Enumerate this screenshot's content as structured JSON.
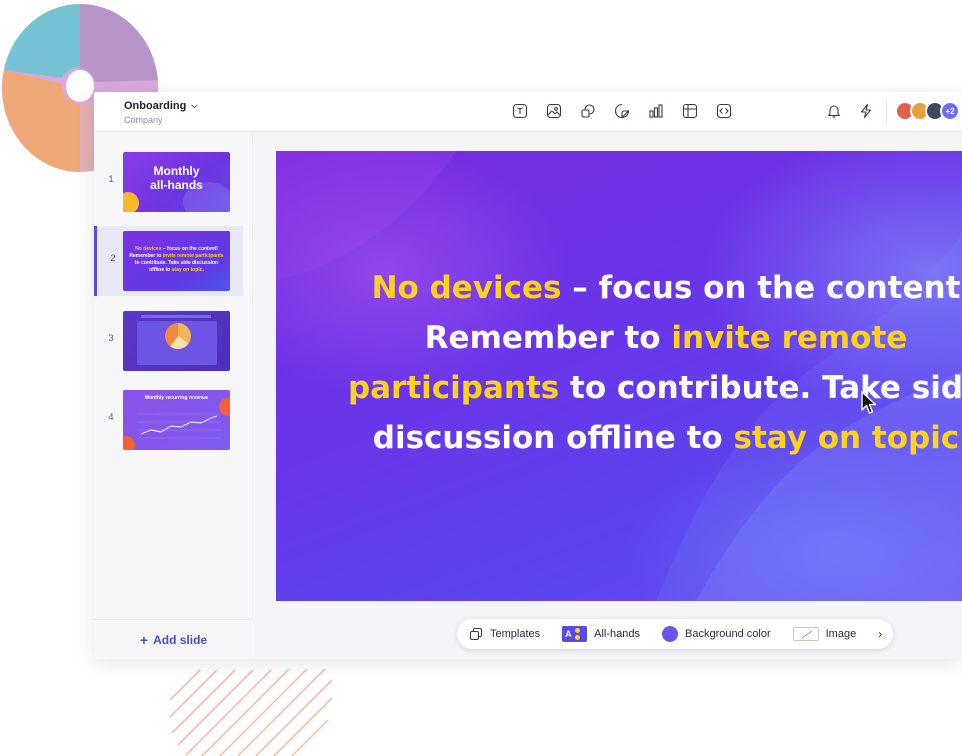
{
  "header": {
    "doc_title": "Onboarding",
    "doc_subtitle": "Company",
    "tools": [
      "text-icon",
      "image-icon",
      "shapes-icon",
      "sticker-icon",
      "chart-icon",
      "table-icon",
      "embed-icon"
    ],
    "notifications_icon": "bell-icon",
    "actions_icon": "lightning-icon",
    "collaborators_extra": "+2",
    "avatar_colors": [
      "#e2604a",
      "#e9a23b",
      "#3f4860",
      "#6b6ff0"
    ]
  },
  "sidebar": {
    "slides": [
      {
        "number": "1",
        "title_line1": "Monthly",
        "title_line2": "all-hands"
      },
      {
        "number": "2",
        "text": [
          "No devices",
          " – focus on the content! Remember to ",
          "invite remote participants",
          " to contribute. Take side discussion offline to ",
          "stay on topic",
          "."
        ]
      },
      {
        "number": "3"
      },
      {
        "number": "4",
        "title": "Monthly recurring revenue"
      }
    ],
    "add_slide_label": "Add slide"
  },
  "slide": {
    "line1_hl": "No devices",
    "line1_rest": " – focus on the content",
    "line2_start": "Remember to ",
    "line2_hl": "invite remote",
    "line3_hl": "participants",
    "line3_rest": " to contribute. Take side",
    "line4_start": "discussion offline to ",
    "line4_hl": "stay on topic"
  },
  "bottom_toolbar": {
    "templates_label": "Templates",
    "theme_chip": "A",
    "theme_label": "All-hands",
    "background_label": "Background color",
    "image_label": "Image",
    "accent_color": "#5a49e6",
    "highlight_color": "#ffd21e"
  }
}
